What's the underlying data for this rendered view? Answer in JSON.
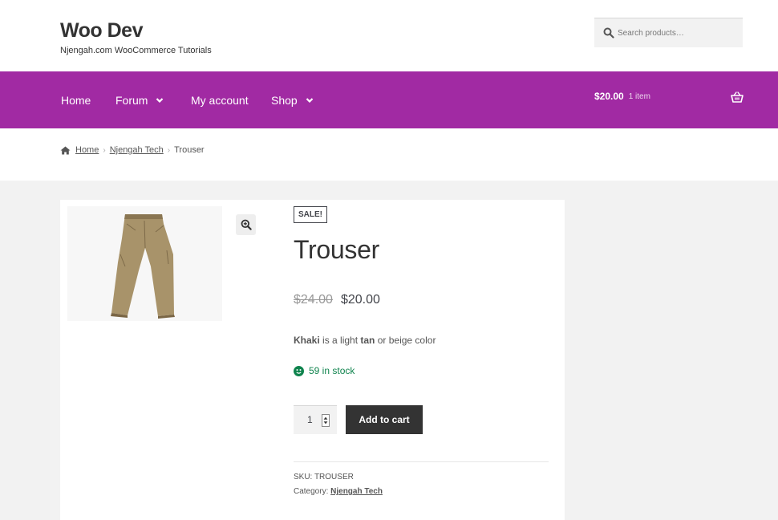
{
  "site": {
    "title": "Woo Dev",
    "description": "Njengah.com WooCommerce Tutorials"
  },
  "search": {
    "placeholder": "Search products…"
  },
  "nav": {
    "items": [
      {
        "label": "Home",
        "has_dropdown": false
      },
      {
        "label": "Forum",
        "has_dropdown": true
      },
      {
        "label": "My account",
        "has_dropdown": false
      },
      {
        "label": "Shop",
        "has_dropdown": true
      }
    ],
    "cart": {
      "amount": "$20.00",
      "count": "1 item"
    }
  },
  "breadcrumb": {
    "home": "Home",
    "category": "Njengah Tech",
    "current": "Trouser"
  },
  "product": {
    "badge": "SALE!",
    "title": "Trouser",
    "regular_price": "$24.00",
    "sale_price": "$20.00",
    "description_bold_1": "Khaki",
    "description_text_1": " is a light ",
    "description_bold_2": "tan",
    "description_text_2": " or beige color",
    "stock": "59 in stock",
    "quantity": "1",
    "add_to_cart": "Add to cart",
    "sku_label": "SKU:",
    "sku": "TROUSER",
    "category_label": "Category:",
    "category": "Njengah Tech"
  },
  "colors": {
    "nav_bg": "#a12aa3",
    "button_bg": "#333333",
    "stock_green": "#0f834d"
  }
}
